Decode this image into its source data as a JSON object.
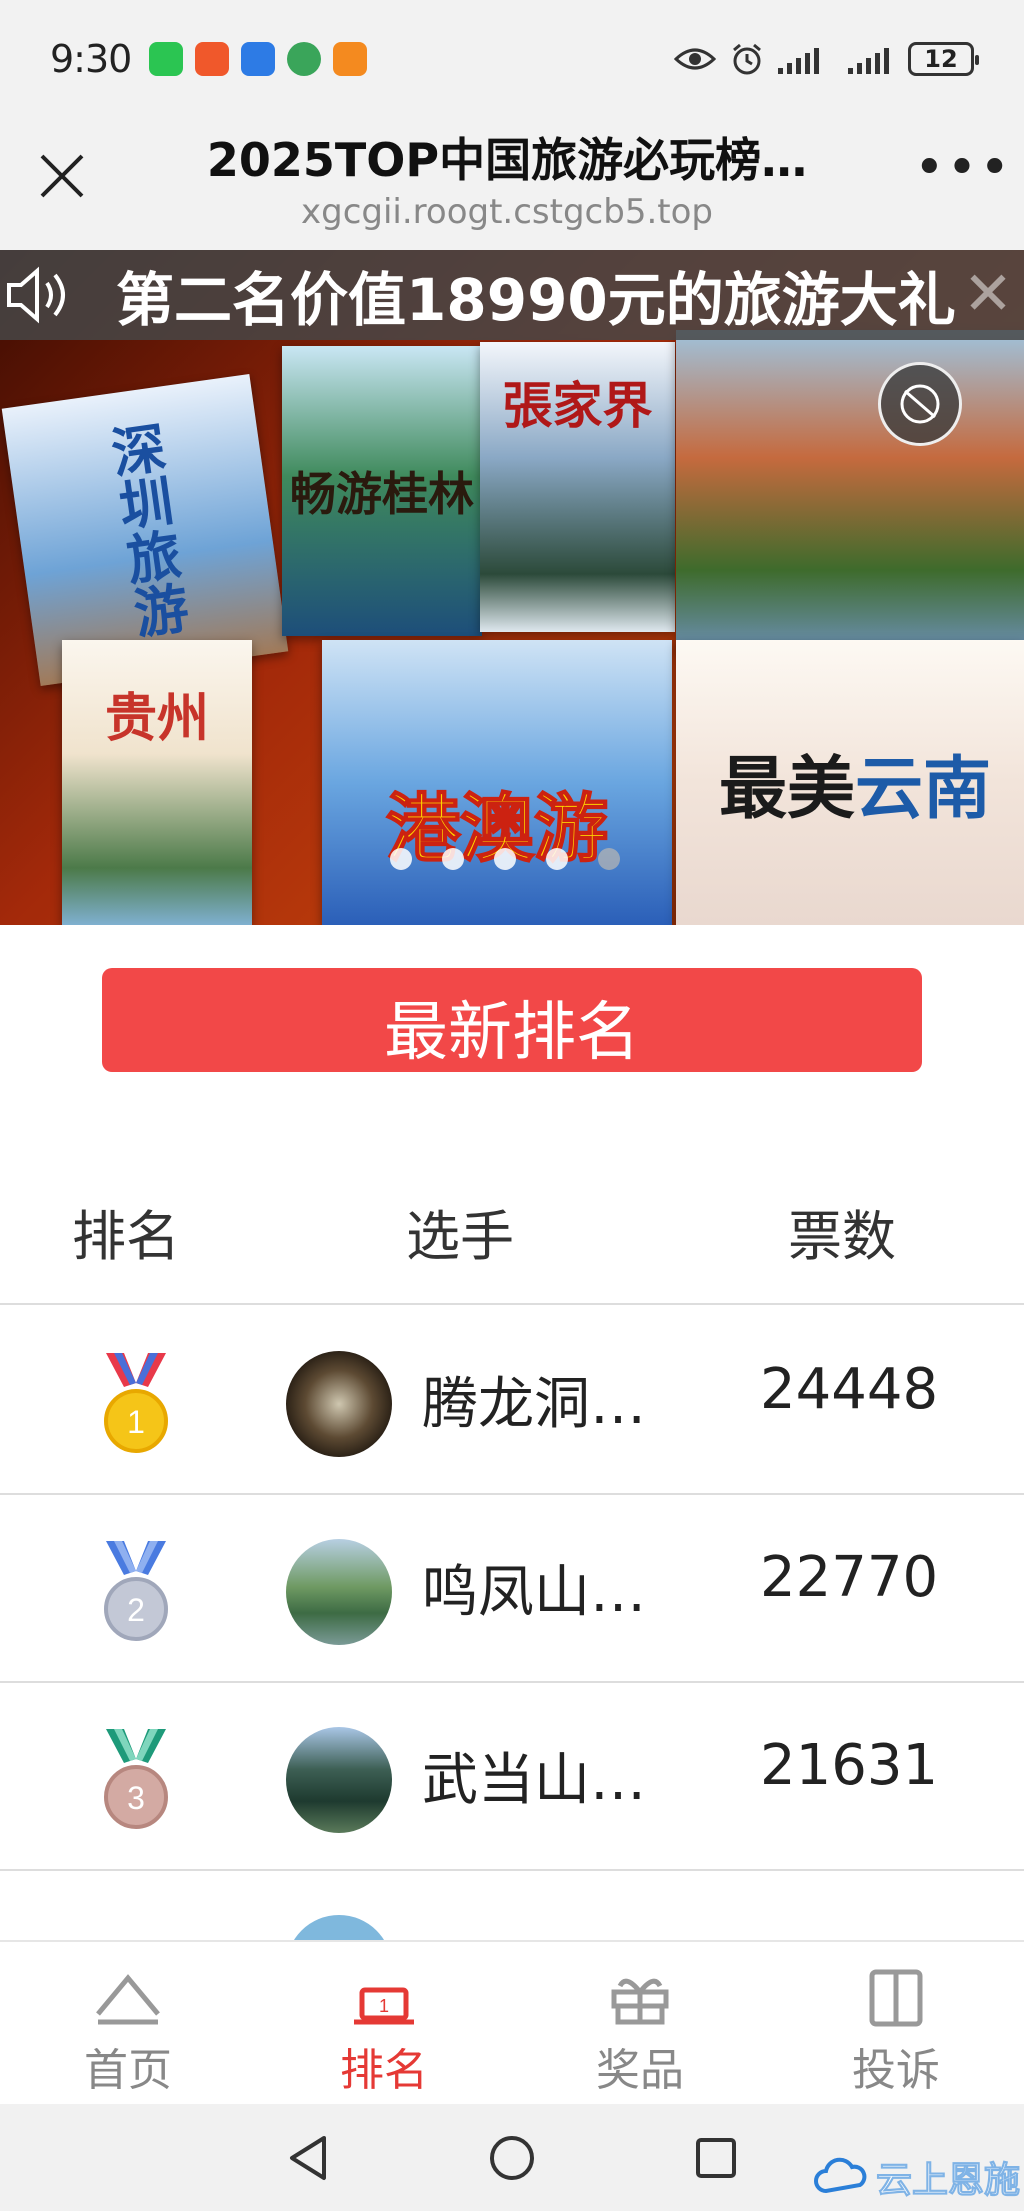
{
  "status_bar": {
    "time": "9:30",
    "battery": "12"
  },
  "header": {
    "title": "2025TOP中国旅游必玩榜…",
    "url": "xgcgii.roogt.cstgcb5.top",
    "more": "•••"
  },
  "banner": {
    "marquee": "第二名价值18990元的旅游大礼",
    "posters": [
      {
        "name": "shenzhen",
        "text": "深圳旅游"
      },
      {
        "name": "guilin",
        "text": "畅游桂林"
      },
      {
        "name": "zhangjiajie",
        "text": "張家界"
      },
      {
        "name": "guizhou",
        "text": "贵州"
      },
      {
        "name": "hk-macau",
        "text": "港澳游"
      },
      {
        "name": "yunnan",
        "text_a": "最美",
        "text_b": "云南"
      }
    ],
    "slide_count": 5,
    "active_slide": 5
  },
  "latest_button": "最新排名",
  "table": {
    "headers": {
      "rank": "排名",
      "player": "选手",
      "votes": "票数"
    },
    "rows": [
      {
        "rank": "1",
        "name": "腾龙洞…",
        "votes": "24448",
        "medal_color": "#f2b705"
      },
      {
        "rank": "2",
        "name": "鸣凤山…",
        "votes": "22770",
        "medal_color": "#b9bfd1"
      },
      {
        "rank": "3",
        "name": "武当山…",
        "votes": "21631",
        "medal_color": "#c9a59b"
      }
    ]
  },
  "bottom_nav": [
    {
      "label": "首页",
      "icon": "home-icon"
    },
    {
      "label": "排名",
      "icon": "ranking-icon",
      "active": true
    },
    {
      "label": "奖品",
      "icon": "gift-icon"
    },
    {
      "label": "投诉",
      "icon": "complaint-book-icon"
    }
  ],
  "watermark": "云上恩施",
  "colors": {
    "accent": "#f24848",
    "active_nav": "#e53935"
  }
}
